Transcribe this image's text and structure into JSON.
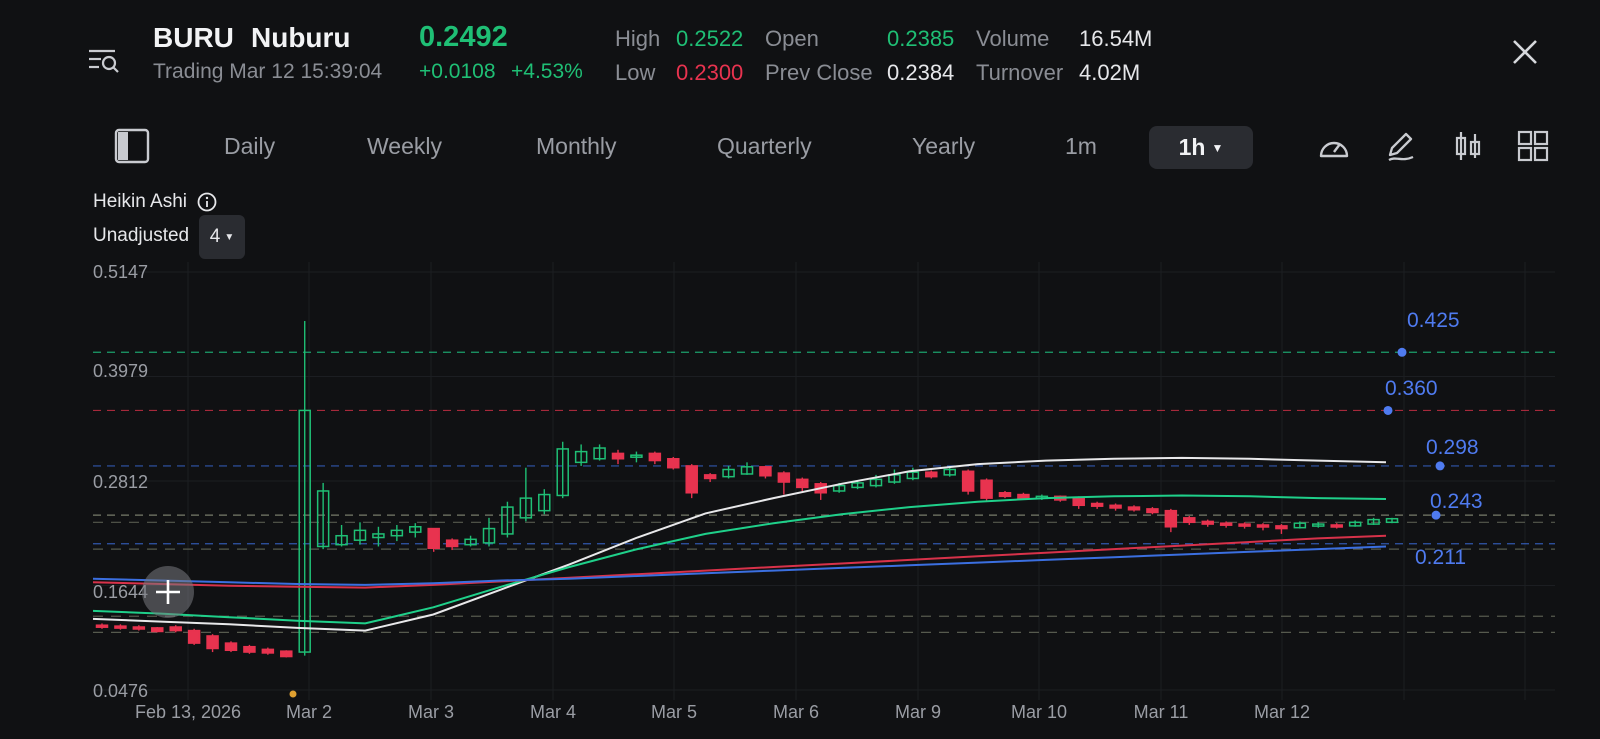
{
  "header": {
    "symbol": "BURU",
    "name": "Nuburu",
    "price": "0.2492",
    "status": "Trading Mar 12 15:39:04",
    "change": "+0.0108",
    "change_pct": "+4.53%",
    "stats": {
      "high_label": "High",
      "high": "0.2522",
      "low_label": "Low",
      "low": "0.2300",
      "open_label": "Open",
      "open": "0.2385",
      "prev_close_label": "Prev Close",
      "prev_close": "0.2384",
      "volume_label": "Volume",
      "volume": "16.54M",
      "turnover_label": "Turnover",
      "turnover": "4.02M"
    },
    "icons": {
      "menu": "list-search-icon",
      "close": "close-icon"
    }
  },
  "toolbar": {
    "tabs": [
      "Daily",
      "Weekly",
      "Monthly",
      "Quarterly",
      "Yearly",
      "1m"
    ],
    "active_tab": "1h",
    "icons": [
      "layout-toggle-icon",
      "gauge-icon",
      "draw-pen-icon",
      "indicator-icon",
      "grid-layout-icon"
    ]
  },
  "chart_options": {
    "type_label": "Heikin Ashi",
    "adjust_label": "Unadjusted",
    "adjust_value": "4"
  },
  "colors": {
    "up": "#1fbf75",
    "down": "#e8334f",
    "ma_white": "#e8e8ea",
    "ma_green": "#1fd08a",
    "ma_red": "#d8324a",
    "ma_blue": "#3b6fe0",
    "level": "#4f7bf0"
  },
  "chart_data": {
    "type": "candlestick",
    "y_ticks": [
      "0.5147",
      "0.3979",
      "0.2812",
      "0.1644",
      "0.0476"
    ],
    "x_ticks": [
      "Feb 13, 2026",
      "Mar 2",
      "Mar 3",
      "Mar 4",
      "Mar 5",
      "Mar 6",
      "Mar 9",
      "Mar 10",
      "Mar 11",
      "Mar 12"
    ],
    "ylim": [
      0.0476,
      0.5147
    ],
    "price_levels": [
      {
        "label": "0.425",
        "value": 0.425,
        "color": "#1fd08a"
      },
      {
        "label": "0.360",
        "value": 0.36,
        "color": "#d8324a"
      },
      {
        "label": "0.298",
        "value": 0.298,
        "color": "#3b6fe0"
      },
      {
        "label": "0.243",
        "value": 0.243,
        "color": "#9aa08a"
      },
      {
        "label": "0.211",
        "value": 0.211,
        "color": "#3b6fe0"
      }
    ],
    "extra_dashed_levels": [
      0.235,
      0.205,
      0.13,
      0.112
    ],
    "candles": [
      {
        "o": 0.12,
        "h": 0.122,
        "l": 0.116,
        "c": 0.118
      },
      {
        "o": 0.119,
        "h": 0.121,
        "l": 0.115,
        "c": 0.117
      },
      {
        "o": 0.118,
        "h": 0.12,
        "l": 0.114,
        "c": 0.116
      },
      {
        "o": 0.117,
        "h": 0.118,
        "l": 0.112,
        "c": 0.113
      },
      {
        "o": 0.118,
        "h": 0.12,
        "l": 0.112,
        "c": 0.114
      },
      {
        "o": 0.114,
        "h": 0.116,
        "l": 0.098,
        "c": 0.1
      },
      {
        "o": 0.108,
        "h": 0.11,
        "l": 0.09,
        "c": 0.094
      },
      {
        "o": 0.1,
        "h": 0.102,
        "l": 0.09,
        "c": 0.092
      },
      {
        "o": 0.096,
        "h": 0.098,
        "l": 0.088,
        "c": 0.09
      },
      {
        "o": 0.093,
        "h": 0.095,
        "l": 0.087,
        "c": 0.089
      },
      {
        "o": 0.091,
        "h": 0.092,
        "l": 0.084,
        "c": 0.085
      },
      {
        "o": 0.09,
        "h": 0.46,
        "l": 0.086,
        "c": 0.36
      },
      {
        "o": 0.208,
        "h": 0.279,
        "l": 0.205,
        "c": 0.27
      },
      {
        "o": 0.21,
        "h": 0.232,
        "l": 0.208,
        "c": 0.22
      },
      {
        "o": 0.215,
        "h": 0.235,
        "l": 0.21,
        "c": 0.226
      },
      {
        "o": 0.218,
        "h": 0.23,
        "l": 0.208,
        "c": 0.222
      },
      {
        "o": 0.22,
        "h": 0.232,
        "l": 0.214,
        "c": 0.226
      },
      {
        "o": 0.224,
        "h": 0.234,
        "l": 0.218,
        "c": 0.23
      },
      {
        "o": 0.228,
        "h": 0.228,
        "l": 0.202,
        "c": 0.206
      },
      {
        "o": 0.215,
        "h": 0.217,
        "l": 0.204,
        "c": 0.208
      },
      {
        "o": 0.21,
        "h": 0.22,
        "l": 0.208,
        "c": 0.216
      },
      {
        "o": 0.212,
        "h": 0.24,
        "l": 0.208,
        "c": 0.228
      },
      {
        "o": 0.222,
        "h": 0.258,
        "l": 0.218,
        "c": 0.252
      },
      {
        "o": 0.24,
        "h": 0.296,
        "l": 0.236,
        "c": 0.262
      },
      {
        "o": 0.248,
        "h": 0.272,
        "l": 0.244,
        "c": 0.266
      },
      {
        "o": 0.265,
        "h": 0.325,
        "l": 0.262,
        "c": 0.317
      },
      {
        "o": 0.302,
        "h": 0.322,
        "l": 0.298,
        "c": 0.314
      },
      {
        "o": 0.306,
        "h": 0.322,
        "l": 0.304,
        "c": 0.318
      },
      {
        "o": 0.312,
        "h": 0.316,
        "l": 0.3,
        "c": 0.306
      },
      {
        "o": 0.31,
        "h": 0.314,
        "l": 0.302,
        "c": 0.31
      },
      {
        "o": 0.312,
        "h": 0.314,
        "l": 0.3,
        "c": 0.304
      },
      {
        "o": 0.306,
        "h": 0.308,
        "l": 0.294,
        "c": 0.296
      },
      {
        "o": 0.298,
        "h": 0.3,
        "l": 0.262,
        "c": 0.268
      },
      {
        "o": 0.288,
        "h": 0.29,
        "l": 0.28,
        "c": 0.284
      },
      {
        "o": 0.286,
        "h": 0.298,
        "l": 0.284,
        "c": 0.294
      },
      {
        "o": 0.289,
        "h": 0.302,
        "l": 0.288,
        "c": 0.297
      },
      {
        "o": 0.297,
        "h": 0.298,
        "l": 0.284,
        "c": 0.287
      },
      {
        "o": 0.29,
        "h": 0.292,
        "l": 0.266,
        "c": 0.28
      },
      {
        "o": 0.283,
        "h": 0.285,
        "l": 0.27,
        "c": 0.274
      },
      {
        "o": 0.278,
        "h": 0.28,
        "l": 0.26,
        "c": 0.268
      },
      {
        "o": 0.27,
        "h": 0.279,
        "l": 0.268,
        "c": 0.276
      },
      {
        "o": 0.274,
        "h": 0.282,
        "l": 0.272,
        "c": 0.279
      },
      {
        "o": 0.276,
        "h": 0.288,
        "l": 0.274,
        "c": 0.283
      },
      {
        "o": 0.28,
        "h": 0.294,
        "l": 0.278,
        "c": 0.288
      },
      {
        "o": 0.284,
        "h": 0.296,
        "l": 0.282,
        "c": 0.291
      },
      {
        "o": 0.291,
        "h": 0.293,
        "l": 0.284,
        "c": 0.286
      },
      {
        "o": 0.288,
        "h": 0.298,
        "l": 0.286,
        "c": 0.294
      },
      {
        "o": 0.292,
        "h": 0.294,
        "l": 0.266,
        "c": 0.27
      },
      {
        "o": 0.282,
        "h": 0.284,
        "l": 0.258,
        "c": 0.262
      },
      {
        "o": 0.268,
        "h": 0.27,
        "l": 0.262,
        "c": 0.264
      },
      {
        "o": 0.266,
        "h": 0.268,
        "l": 0.26,
        "c": 0.262
      },
      {
        "o": 0.262,
        "h": 0.266,
        "l": 0.26,
        "c": 0.264
      },
      {
        "o": 0.264,
        "h": 0.265,
        "l": 0.258,
        "c": 0.26
      },
      {
        "o": 0.262,
        "h": 0.264,
        "l": 0.25,
        "c": 0.254
      },
      {
        "o": 0.256,
        "h": 0.258,
        "l": 0.25,
        "c": 0.253
      },
      {
        "o": 0.254,
        "h": 0.256,
        "l": 0.248,
        "c": 0.251
      },
      {
        "o": 0.252,
        "h": 0.254,
        "l": 0.247,
        "c": 0.249
      },
      {
        "o": 0.25,
        "h": 0.252,
        "l": 0.244,
        "c": 0.246
      },
      {
        "o": 0.248,
        "h": 0.25,
        "l": 0.224,
        "c": 0.23
      },
      {
        "o": 0.24,
        "h": 0.242,
        "l": 0.232,
        "c": 0.235
      },
      {
        "o": 0.236,
        "h": 0.238,
        "l": 0.23,
        "c": 0.233
      },
      {
        "o": 0.234,
        "h": 0.236,
        "l": 0.229,
        "c": 0.232
      },
      {
        "o": 0.233,
        "h": 0.235,
        "l": 0.228,
        "c": 0.231
      },
      {
        "o": 0.232,
        "h": 0.234,
        "l": 0.226,
        "c": 0.23
      },
      {
        "o": 0.231,
        "h": 0.233,
        "l": 0.222,
        "c": 0.228
      },
      {
        "o": 0.229,
        "h": 0.236,
        "l": 0.228,
        "c": 0.234
      },
      {
        "o": 0.231,
        "h": 0.235,
        "l": 0.229,
        "c": 0.233
      },
      {
        "o": 0.232,
        "h": 0.234,
        "l": 0.228,
        "c": 0.23
      },
      {
        "o": 0.231,
        "h": 0.237,
        "l": 0.23,
        "c": 0.235
      },
      {
        "o": 0.233,
        "h": 0.24,
        "l": 0.232,
        "c": 0.238
      },
      {
        "o": 0.235,
        "h": 0.24,
        "l": 0.234,
        "c": 0.239
      }
    ],
    "moving_averages": [
      {
        "color": "#e8e8ea",
        "values": [
          0.127,
          0.124,
          0.121,
          0.117,
          0.114,
          0.132,
          0.16,
          0.188,
          0.218,
          0.245,
          0.262,
          0.278,
          0.292,
          0.3,
          0.304,
          0.306,
          0.307,
          0.306,
          0.304,
          0.302
        ]
      },
      {
        "color": "#1fd08a",
        "values": [
          0.136,
          0.133,
          0.129,
          0.125,
          0.122,
          0.14,
          0.163,
          0.185,
          0.205,
          0.222,
          0.234,
          0.244,
          0.252,
          0.258,
          0.262,
          0.264,
          0.265,
          0.264,
          0.262,
          0.261
        ]
      },
      {
        "color": "#d8324a",
        "values": [
          0.168,
          0.166,
          0.164,
          0.163,
          0.162,
          0.165,
          0.169,
          0.173,
          0.177,
          0.181,
          0.185,
          0.189,
          0.193,
          0.197,
          0.201,
          0.205,
          0.209,
          0.213,
          0.217,
          0.22
        ]
      },
      {
        "color": "#3b6fe0",
        "values": [
          0.172,
          0.17,
          0.168,
          0.166,
          0.165,
          0.167,
          0.17,
          0.172,
          0.175,
          0.178,
          0.181,
          0.184,
          0.187,
          0.19,
          0.193,
          0.196,
          0.199,
          0.202,
          0.205,
          0.208
        ]
      }
    ]
  }
}
